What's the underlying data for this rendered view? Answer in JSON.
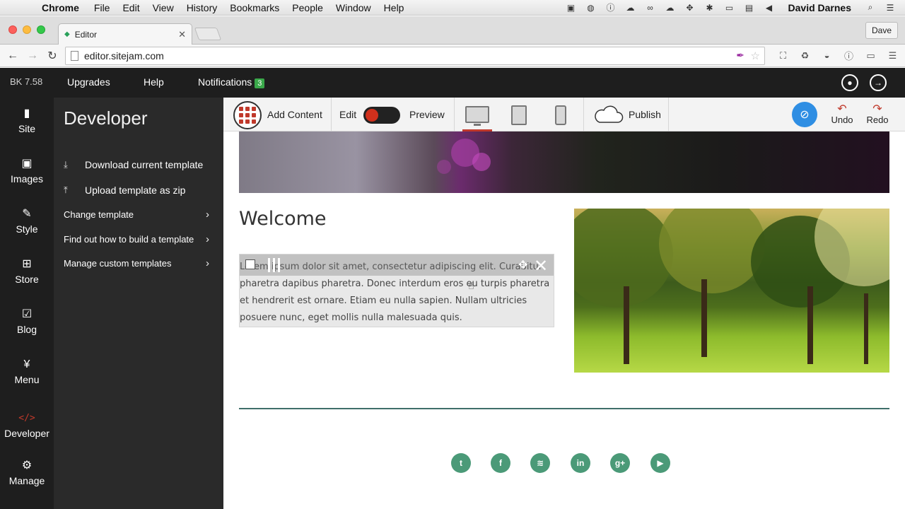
{
  "os_menubar": {
    "apple": "",
    "app": "Chrome",
    "menus": [
      "File",
      "Edit",
      "View",
      "History",
      "Bookmarks",
      "People",
      "Window",
      "Help"
    ],
    "user": "David Darnes"
  },
  "browser": {
    "tab_title": "Editor",
    "profile": "Dave",
    "url": "editor.sitejam.com"
  },
  "appbar": {
    "version": "BK 7.58",
    "upgrades": "Upgrades",
    "help": "Help",
    "notifications": "Notifications",
    "notification_count": "3"
  },
  "rail": {
    "items": [
      {
        "label": "Site",
        "icon": "file-icon"
      },
      {
        "label": "Images",
        "icon": "image-icon"
      },
      {
        "label": "Style",
        "icon": "brush-icon"
      },
      {
        "label": "Store",
        "icon": "cart-icon"
      },
      {
        "label": "Blog",
        "icon": "edit-icon"
      },
      {
        "label": "Menu",
        "icon": "fork-knife-icon"
      },
      {
        "label": "Developer",
        "icon": "code-icon",
        "glyph": "</>"
      },
      {
        "label": "Manage",
        "icon": "gear-icon"
      }
    ]
  },
  "panel": {
    "title": "Developer",
    "items": [
      {
        "label": "Download current template",
        "icon": "download-icon"
      },
      {
        "label": "Upload template as zip",
        "icon": "upload-icon"
      },
      {
        "label": "Change template"
      },
      {
        "label": "Find out how to build a template"
      },
      {
        "label": "Manage custom templates"
      }
    ]
  },
  "editbar": {
    "add_content": "Add Content",
    "edit": "Edit",
    "preview": "Preview",
    "publish": "Publish",
    "undo": "Undo",
    "redo": "Redo",
    "mode_toggle_on": false
  },
  "page": {
    "heading": "Welcome",
    "body_text": "Lorem ipsum dolor sit amet, consectetur adipiscing elit. Curabitur pharetra dapibus pharetra. Donec interdum eros eu turpis pharetra et hendrerit est ornare. Etiam eu nulla sapien. Nullam ultricies posuere nunc, eget mollis nulla malesuada quis.",
    "social": [
      {
        "icon": "twitter-icon",
        "glyph": "t"
      },
      {
        "icon": "facebook-icon",
        "glyph": "f"
      },
      {
        "icon": "rss-icon",
        "glyph": "≋"
      },
      {
        "icon": "linkedin-icon",
        "glyph": "in"
      },
      {
        "icon": "google-plus-icon",
        "glyph": "g+"
      },
      {
        "icon": "youtube-icon",
        "glyph": "▶"
      }
    ]
  },
  "colors": {
    "accent_red": "#c0392b",
    "social_green": "#4b9a78",
    "badge_green": "#3aa84a",
    "visibility_blue": "#2f8ee3"
  }
}
